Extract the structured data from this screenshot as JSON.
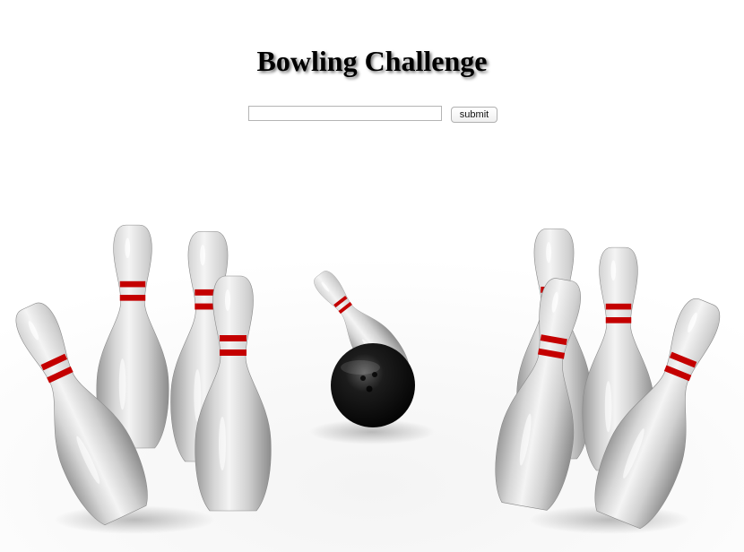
{
  "page": {
    "title": "Bowling Challenge"
  },
  "form": {
    "input_value": "",
    "input_placeholder": "",
    "submit_label": "submit"
  },
  "hero_image": {
    "subject": "bowling ball striking pins",
    "colors": {
      "ball": "#111111",
      "pin": "#d9d9d9",
      "stripe": "#c40000"
    }
  }
}
